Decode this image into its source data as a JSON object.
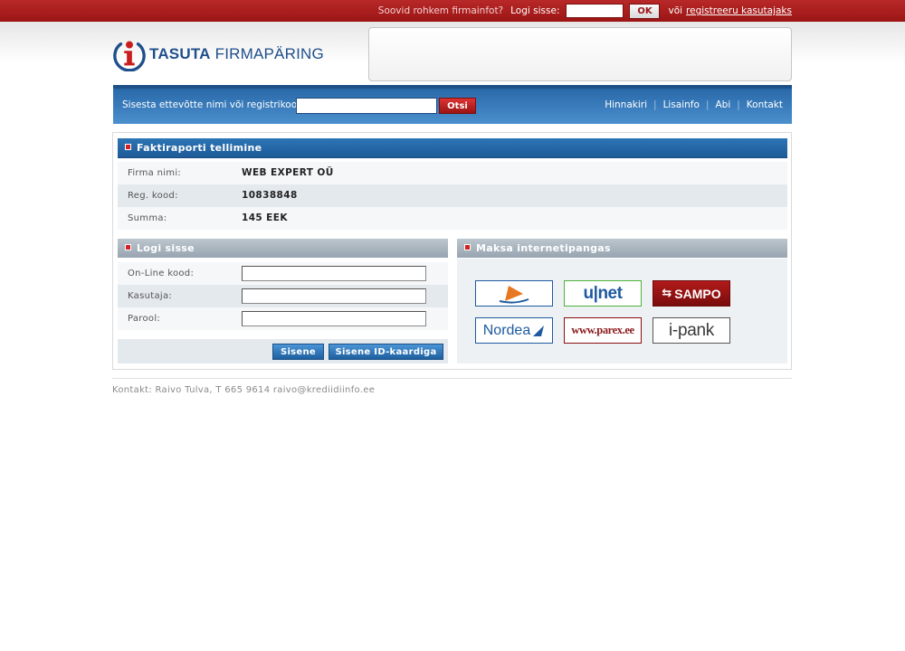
{
  "topbar": {
    "prompt": "Soovid rohkem firmainfot?",
    "login_label": "Logi sisse:",
    "ok_label": "OK",
    "or_text": "või",
    "register_link": "registreeru kasutajaks"
  },
  "logo": {
    "word1": "TASUTA",
    "word2": "FIRMAPÄRING"
  },
  "search": {
    "label": "Sisesta ettevõtte nimi või registrikood:",
    "button": "Otsi",
    "nav": [
      "Hinnakiri",
      "Lisainfo",
      "Abi",
      "Kontakt"
    ]
  },
  "invoice": {
    "title": "Faktiraporti tellimine",
    "rows": [
      {
        "key": "Firma nimi:",
        "value": "WEB EXPERT OÜ"
      },
      {
        "key": "Reg. kood:",
        "value": "10838848"
      },
      {
        "key": "Summa:",
        "value": "145 EEK"
      }
    ]
  },
  "login": {
    "title": "Logi sisse",
    "fields": [
      {
        "label": "On-Line kood:",
        "value": ""
      },
      {
        "label": "Kasutaja:",
        "value": ""
      },
      {
        "label": "Parool:",
        "value": ""
      }
    ],
    "submit": "Sisene",
    "id_card": "Sisene ID-kaardiga"
  },
  "payment": {
    "title": "Maksa internetipangas",
    "banks": [
      {
        "name": "Hansapank",
        "text": "",
        "border": "#1e5aa0"
      },
      {
        "name": "U-Net",
        "text": "u|net",
        "border": "#4bb33a"
      },
      {
        "name": "Sampo",
        "text": "SAMPO",
        "border": "#8a0e0e"
      },
      {
        "name": "Nordea",
        "text": "Nordea",
        "border": "#1e5aa0"
      },
      {
        "name": "Parex",
        "text": "www.parex.ee",
        "border": "#8a0e0e"
      },
      {
        "name": "i-pank",
        "text": "i-pank",
        "border": "#555555"
      }
    ]
  },
  "footer": {
    "contact": "Kontakt: Raivo Tulva, T 665 9614 raivo@krediidiinfo.ee"
  },
  "colors": {
    "top_red": "#b01c1c",
    "brand_blue": "#1e4f8c",
    "header_blue": "#2a6aaa"
  }
}
